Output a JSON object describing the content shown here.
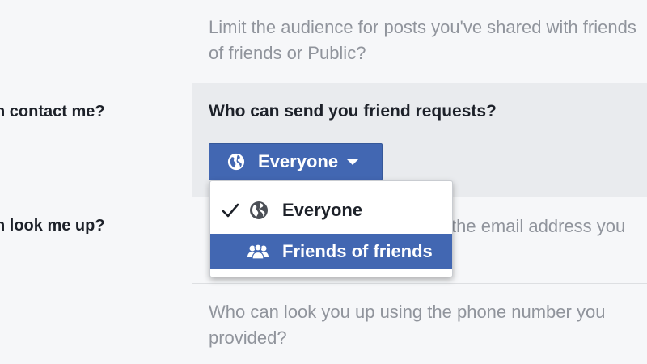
{
  "past_posts": {
    "description": "Limit the audience for posts you've shared with friends of friends or Public?"
  },
  "contact_section": {
    "label": "n contact me?",
    "question": "Who can send you friend requests?",
    "selected_audience": "Everyone",
    "globe_icon": "globe-icon",
    "dropdown": {
      "items": [
        {
          "label": "Everyone",
          "icon": "globe-icon",
          "checked": true
        },
        {
          "label": "Friends of friends",
          "icon": "friends-icon",
          "highlighted": true
        }
      ]
    }
  },
  "lookup_section": {
    "label": "n look me up?",
    "email_question_visible": "the email address you",
    "phone_question": "Who can look you up using the phone number you provided?"
  },
  "colors": {
    "button_blue": "#4267b2",
    "muted_text": "#90949c",
    "active_row_bg": "#e9ebee"
  }
}
